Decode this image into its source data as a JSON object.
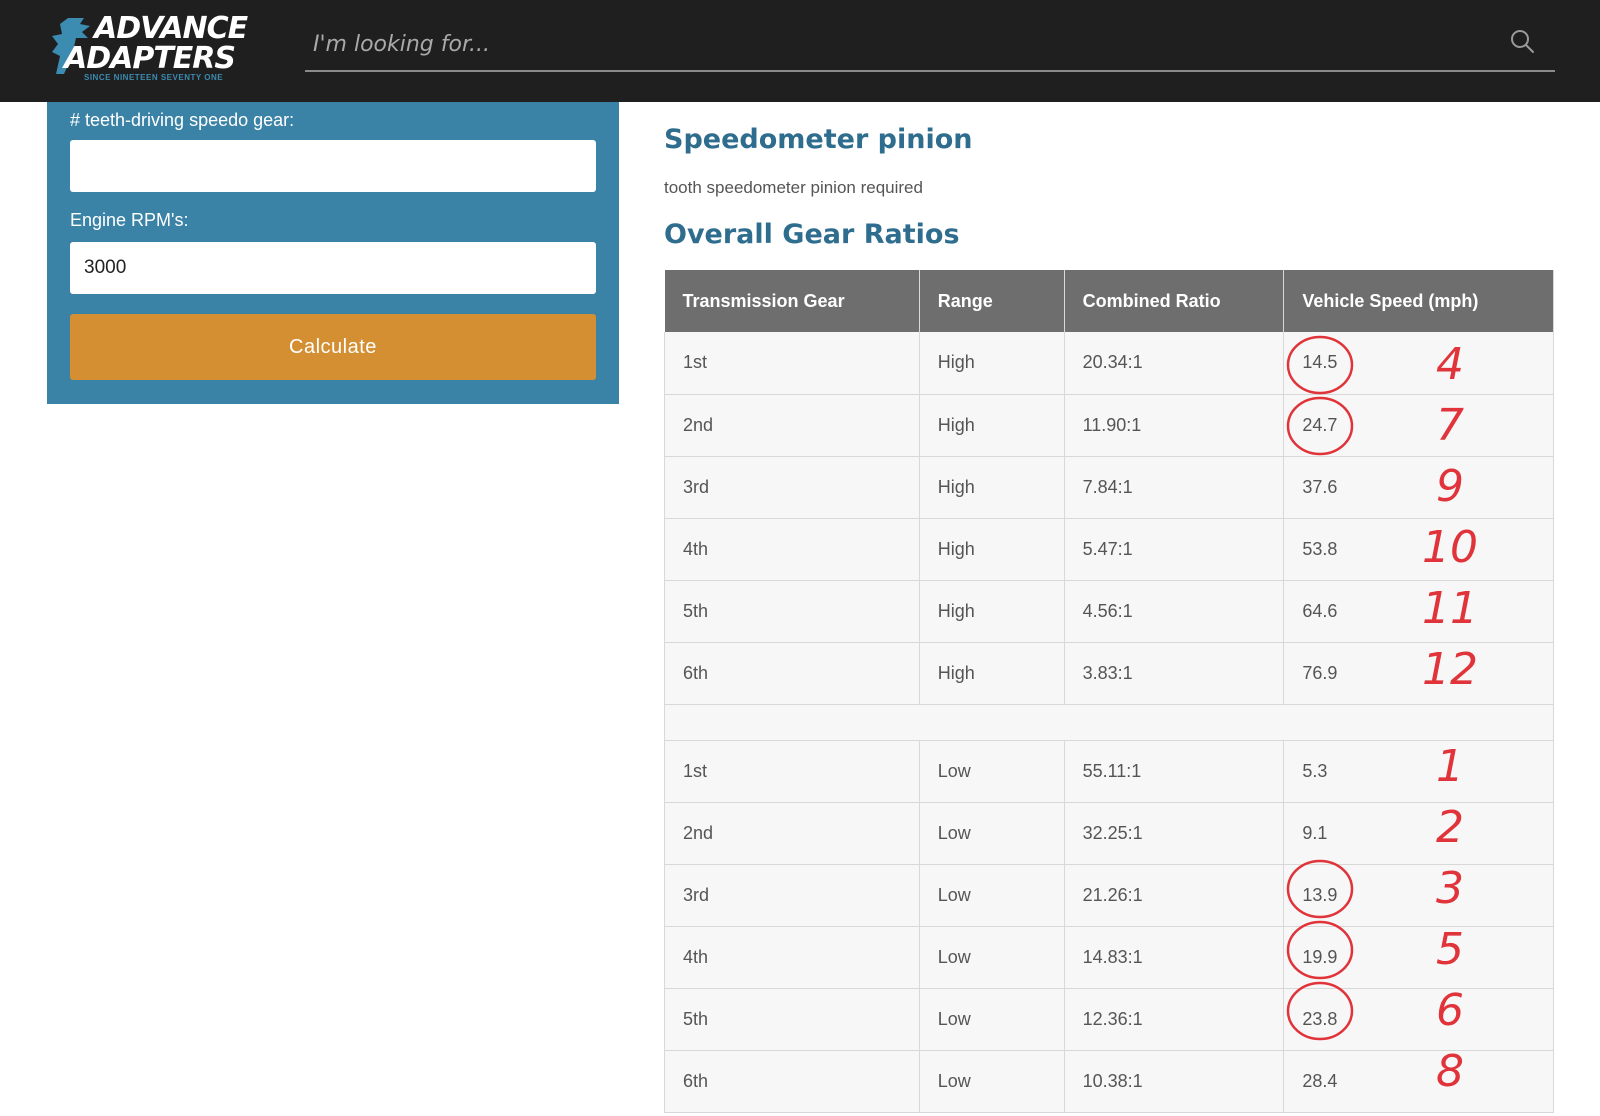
{
  "header": {
    "logo": {
      "line1": "ADVANCE",
      "line2": "ADAPTERS",
      "tagline": "SINCE NINETEEN SEVENTY ONE"
    },
    "search": {
      "placeholder": "I'm looking for..."
    },
    "icons": {
      "search": "search-icon"
    }
  },
  "form": {
    "speedo_gear_label": "# teeth-driving speedo gear:",
    "speedo_gear_value": "",
    "rpm_label": "Engine RPM's:",
    "rpm_value": "3000",
    "calculate_label": "Calculate"
  },
  "results": {
    "pinion_title": "Speedometer pinion",
    "pinion_text": "tooth speedometer pinion required",
    "ratios_title": "Overall Gear Ratios",
    "columns": [
      "Transmission Gear",
      "Range",
      "Combined Ratio",
      "Vehicle Speed (mph)"
    ],
    "high_rows": [
      {
        "gear": "1st",
        "range": "High",
        "ratio": "20.34:1",
        "speed": "14.5"
      },
      {
        "gear": "2nd",
        "range": "High",
        "ratio": "11.90:1",
        "speed": "24.7"
      },
      {
        "gear": "3rd",
        "range": "High",
        "ratio": "7.84:1",
        "speed": "37.6"
      },
      {
        "gear": "4th",
        "range": "High",
        "ratio": "5.47:1",
        "speed": "53.8"
      },
      {
        "gear": "5th",
        "range": "High",
        "ratio": "4.56:1",
        "speed": "64.6"
      },
      {
        "gear": "6th",
        "range": "High",
        "ratio": "3.83:1",
        "speed": "76.9"
      }
    ],
    "low_rows": [
      {
        "gear": "1st",
        "range": "Low",
        "ratio": "55.11:1",
        "speed": "5.3"
      },
      {
        "gear": "2nd",
        "range": "Low",
        "ratio": "32.25:1",
        "speed": "9.1"
      },
      {
        "gear": "3rd",
        "range": "Low",
        "ratio": "21.26:1",
        "speed": "13.9"
      },
      {
        "gear": "4th",
        "range": "Low",
        "ratio": "14.83:1",
        "speed": "19.9"
      },
      {
        "gear": "5th",
        "range": "Low",
        "ratio": "12.36:1",
        "speed": "23.8"
      },
      {
        "gear": "6th",
        "range": "Low",
        "ratio": "10.38:1",
        "speed": "28.4"
      }
    ]
  },
  "annotations": {
    "color": "#e0333a",
    "high_numbers": [
      "4",
      "7",
      "9",
      "10",
      "11",
      "12"
    ],
    "low_numbers": [
      "1",
      "2",
      "3",
      "5",
      "6",
      "8"
    ]
  },
  "colors": {
    "header_bg": "#1f1f1f",
    "panel_bg": "#3b83a6",
    "button_bg": "#d58f33",
    "heading": "#2e6d8e",
    "table_header_bg": "#6e6e6e"
  }
}
